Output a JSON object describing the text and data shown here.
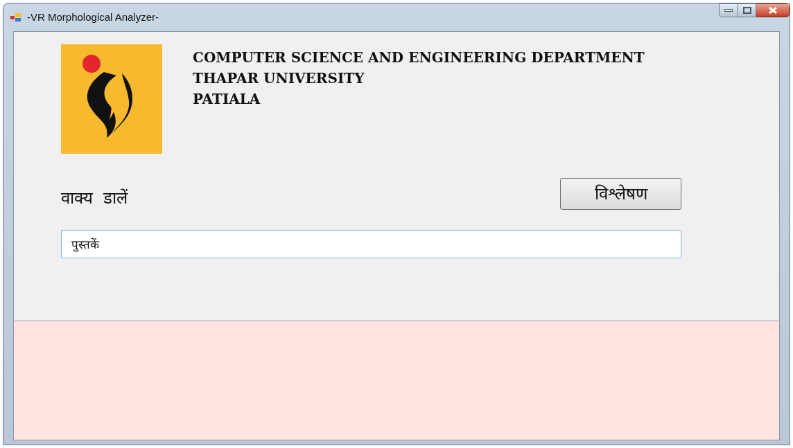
{
  "window": {
    "title": "-VR Morphological Analyzer-"
  },
  "header": {
    "lines": [
      "COMPUTER SCIENCE AND ENGINEERING DEPARTMENT",
      "THAPAR UNIVERSITY",
      "PATIALA"
    ]
  },
  "input_label": "वाक्य  डालें",
  "analyze_button": "विश्लेषण",
  "sentence_field": {
    "value": "पुस्तकें"
  }
}
